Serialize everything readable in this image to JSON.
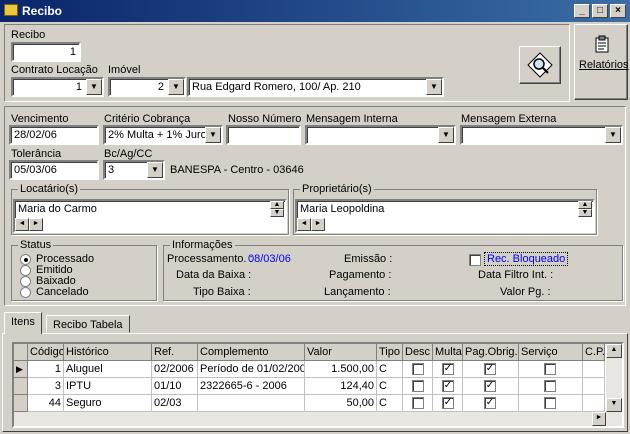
{
  "window": {
    "title": "Recibo"
  },
  "header": {
    "recibo_label": "Recibo",
    "recibo_value": "1",
    "contrato_label": "Contrato Locação",
    "contrato_value": "1",
    "imovel_label": "Imóvel",
    "imovel_code": "2",
    "imovel_address": "Rua Edgard Romero, 100/ Ap. 210",
    "relatorios_label": "Relatórios"
  },
  "form": {
    "vencimento_label": "Vencimento",
    "vencimento_value": "28/02/06",
    "criterio_label": "Critério Cobrança",
    "criterio_value": "2% Multa + 1% Juros",
    "nosso_label": "Nosso Número",
    "nosso_value": "",
    "msg_interna_label": "Mensagem Interna",
    "msg_interna_value": "",
    "msg_externa_label": "Mensagem Externa",
    "msg_externa_value": "",
    "tolerancia_label": "Tolerância",
    "tolerancia_value": "05/03/06",
    "bcag_label": "Bc/Ag/CC",
    "bcag_value": "3",
    "bank_name": "BANESPA - Centro - 03646",
    "locatario_label": "Locatário(s)",
    "locatario_value": "Maria do Carmo",
    "proprietario_label": "Proprietário(s)",
    "proprietario_value": "Maria Leopoldina"
  },
  "status": {
    "title": "Status",
    "options": [
      "Processado",
      "Emitido",
      "Baixado",
      "Cancelado"
    ],
    "selected": "Processado"
  },
  "info": {
    "title": "Informações",
    "processamento_label": "Processamento. :",
    "processamento_value": "08/03/06",
    "emissao_label": "Emissão :",
    "data_baixa_label": "Data da Baixa :",
    "pagamento_label": "Pagamento :",
    "tipo_baixa_label": "Tipo Baixa :",
    "lancamento_label": "Lançamento :",
    "rec_bloqueado_label": "Rec. Bloqueado",
    "data_filtro_label": "Data Filtro Int. :",
    "valor_pg_label": "Valor Pg. :"
  },
  "tabs": [
    "Itens",
    "Recibo Tabela"
  ],
  "table": {
    "columns": [
      "Código",
      "Histórico",
      "Ref.",
      "Complemento",
      "Valor",
      "Tipo",
      "Desc",
      "Multa",
      "Pag.Obrig.",
      "Serviço",
      "C.P."
    ],
    "rows": [
      {
        "codigo": "1",
        "historico": "Aluguel",
        "ref": "02/2006",
        "complemento": "Período de 01/02/200",
        "valor": "1.500,00",
        "tipo": "C",
        "desc": false,
        "multa": true,
        "pag": true,
        "servico": false
      },
      {
        "codigo": "3",
        "historico": "IPTU",
        "ref": "01/10",
        "complemento": "2322665-6 - 2006",
        "valor": "124,40",
        "tipo": "C",
        "desc": false,
        "multa": true,
        "pag": true,
        "servico": false
      },
      {
        "codigo": "44",
        "historico": "Seguro",
        "ref": "02/03",
        "complemento": "",
        "valor": "50,00",
        "tipo": "C",
        "desc": false,
        "multa": true,
        "pag": true,
        "servico": false
      }
    ]
  },
  "colors": {
    "title_start": "#0a246a",
    "title_end": "#3a6ea5",
    "link": "#0000ff"
  }
}
